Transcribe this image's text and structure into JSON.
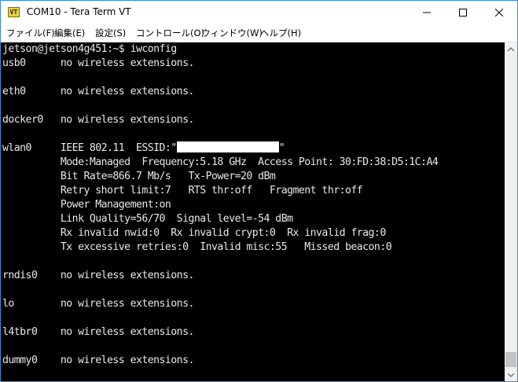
{
  "window": {
    "title": "COM10 - Tera Term VT",
    "icon_label": "VT"
  },
  "menu": [
    {
      "label": "ファイル(F)"
    },
    {
      "label": "編集(E)"
    },
    {
      "label": "設定(S)"
    },
    {
      "label": "コントロール(O)"
    },
    {
      "label": "ウィンドウ(W)"
    },
    {
      "label": "ヘルプ(H)"
    }
  ],
  "terminal": {
    "lines": [
      "jetson@jetson4g451:~$ iwconfig",
      "usb0      no wireless extensions.",
      "",
      "eth0      no wireless extensions.",
      "",
      "docker0   no wireless extensions.",
      "",
      "wlan0     IEEE 802.11  ESSID:\"",
      "          Mode:Managed  Frequency:5.18 GHz  Access Point: 30:FD:38:D5:1C:A4",
      "          Bit Rate=866.7 Mb/s   Tx-Power=20 dBm",
      "          Retry short limit:7   RTS thr:off   Fragment thr:off",
      "          Power Management:on",
      "          Link Quality=56/70  Signal level=-54 dBm",
      "          Rx invalid nwid:0  Rx invalid crypt:0  Rx invalid frag:0",
      "          Tx excessive retries:0  Invalid misc:55   Missed beacon:0",
      "",
      "rndis0    no wireless extensions.",
      "",
      "lo        no wireless extensions.",
      "",
      "l4tbr0    no wireless extensions.",
      "",
      "dummy0    no wireless extensions."
    ],
    "essid_suffix": "\""
  },
  "colors": {
    "terminal_bg": "#000000",
    "terminal_fg": "#e8e8e8",
    "essid_redaction": "#ffffff"
  }
}
